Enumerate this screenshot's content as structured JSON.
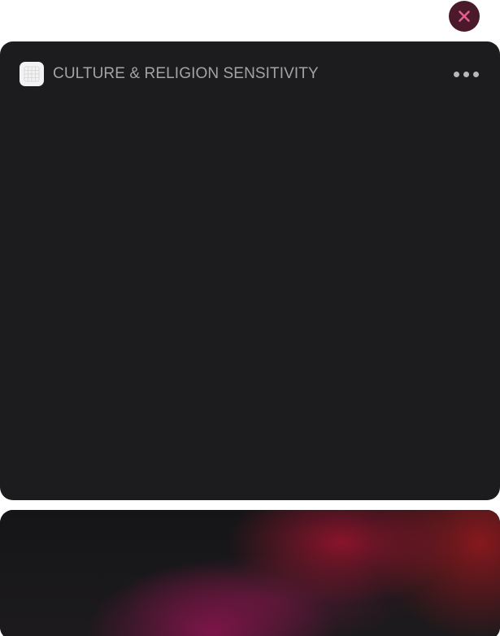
{
  "colors": {
    "close_button_bg": "#4a1a2b",
    "close_icon": "#e0608e",
    "card_bg": "#1c1c1e",
    "title_text": "#a3a3a6",
    "banner_accent": "#8b1a3a"
  },
  "dialog": {
    "close_icon": "close-icon"
  },
  "card": {
    "app_icon": "grid-icon",
    "title": "CULTURE & RELIGION SENSITIVITY",
    "more_icon": "more-horizontal-icon"
  }
}
